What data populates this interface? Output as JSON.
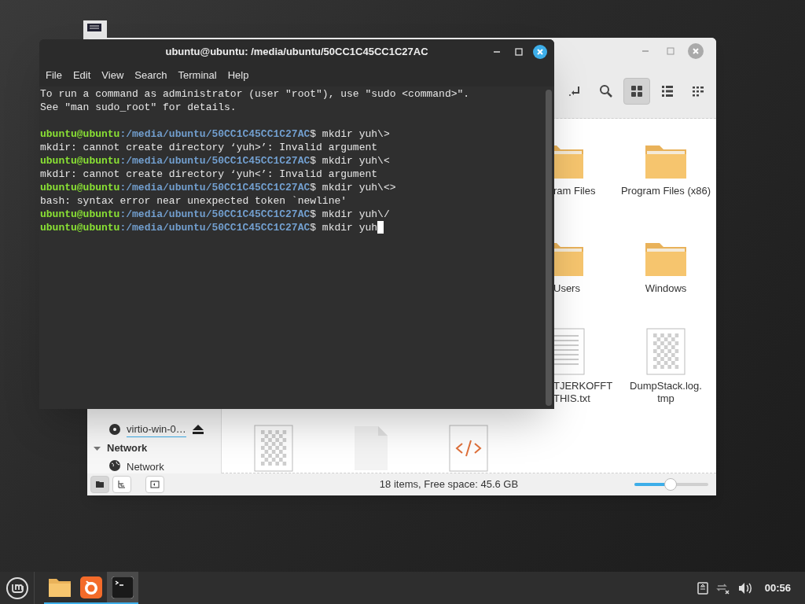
{
  "file_manager": {
    "window_buttons": [
      {
        "kind": "minimize"
      },
      {
        "kind": "maximize"
      },
      {
        "kind": "close"
      }
    ],
    "toolbar": [
      {
        "kind": "jump",
        "selected": false
      },
      {
        "kind": "search",
        "selected": false
      },
      {
        "kind": "grid",
        "selected": true
      },
      {
        "kind": "list",
        "selected": false
      },
      {
        "kind": "compact",
        "selected": false
      }
    ],
    "partial_items": [
      {
        "label": "ram Files",
        "kind": "folder"
      },
      {
        "label": "Users",
        "kind": "folder"
      },
      {
        "label": "TJERKOFFT\nTHIS.txt",
        "kind": "text"
      }
    ],
    "items": [
      {
        "label": "Program Files (x86)",
        "kind": "folder"
      },
      {
        "label": "Windows",
        "kind": "folder"
      },
      {
        "label": "DumpStack.log.\ntmp",
        "kind": "image"
      }
    ],
    "bottom_items": [
      {
        "kind": "image"
      },
      {
        "kind": "blank"
      },
      {
        "kind": "code"
      }
    ],
    "sidebar": {
      "devices": [
        {
          "label": "virtio-win-0…"
        }
      ],
      "sections": [
        {
          "title": "Network",
          "expanded": true,
          "items": [
            {
              "label": "Network"
            }
          ]
        }
      ]
    },
    "status_buttons": [
      {
        "kind": "places",
        "selected": true
      },
      {
        "kind": "tree",
        "selected": false
      },
      {
        "kind": "sidebar",
        "selected": false
      }
    ],
    "status_text": "18 items, Free space: 45.6 GB",
    "zoom": {
      "level": 0.49
    }
  },
  "terminal": {
    "title": "ubuntu@ubuntu: /media/ubuntu/50CC1C45CC1C27AC",
    "menu": [
      "File",
      "Edit",
      "View",
      "Search",
      "Terminal",
      "Help"
    ],
    "lines": [
      {
        "kind": "text",
        "text": "To run a command as administrator (user \"root\"), use \"sudo <command>\"."
      },
      {
        "kind": "text",
        "text": "See \"man sudo_root\" for details."
      },
      {
        "kind": "blank"
      },
      {
        "kind": "prompt",
        "user": "ubuntu@ubuntu",
        "path": ":/media/ubuntu/50CC1C45CC1C27AC",
        "command": "$ mkdir yuh\\>",
        "cursor": false
      },
      {
        "kind": "text",
        "text": "mkdir: cannot create directory ‘yuh>’: Invalid argument"
      },
      {
        "kind": "prompt",
        "user": "ubuntu@ubuntu",
        "path": ":/media/ubuntu/50CC1C45CC1C27AC",
        "command": "$ mkdir yuh\\<",
        "cursor": false
      },
      {
        "kind": "text",
        "text": "mkdir: cannot create directory ‘yuh<’: Invalid argument"
      },
      {
        "kind": "prompt",
        "user": "ubuntu@ubuntu",
        "path": ":/media/ubuntu/50CC1C45CC1C27AC",
        "command": "$ mkdir yuh\\<>",
        "cursor": false
      },
      {
        "kind": "text",
        "text": "bash: syntax error near unexpected token `newline'"
      },
      {
        "kind": "prompt",
        "user": "ubuntu@ubuntu",
        "path": ":/media/ubuntu/50CC1C45CC1C27AC",
        "command": "$ mkdir yuh\\/",
        "cursor": false
      },
      {
        "kind": "prompt",
        "user": "ubuntu@ubuntu",
        "path": ":/media/ubuntu/50CC1C45CC1C27AC",
        "command": "$ mkdir yuh",
        "cursor": true
      }
    ]
  },
  "taskbar": {
    "apps": [
      {
        "kind": "files",
        "active": false
      },
      {
        "kind": "browser",
        "active": false
      },
      {
        "kind": "terminal",
        "active": true
      }
    ],
    "tray": [
      {
        "kind": "notes"
      },
      {
        "kind": "network"
      },
      {
        "kind": "volume"
      }
    ],
    "clock": "00:56"
  }
}
